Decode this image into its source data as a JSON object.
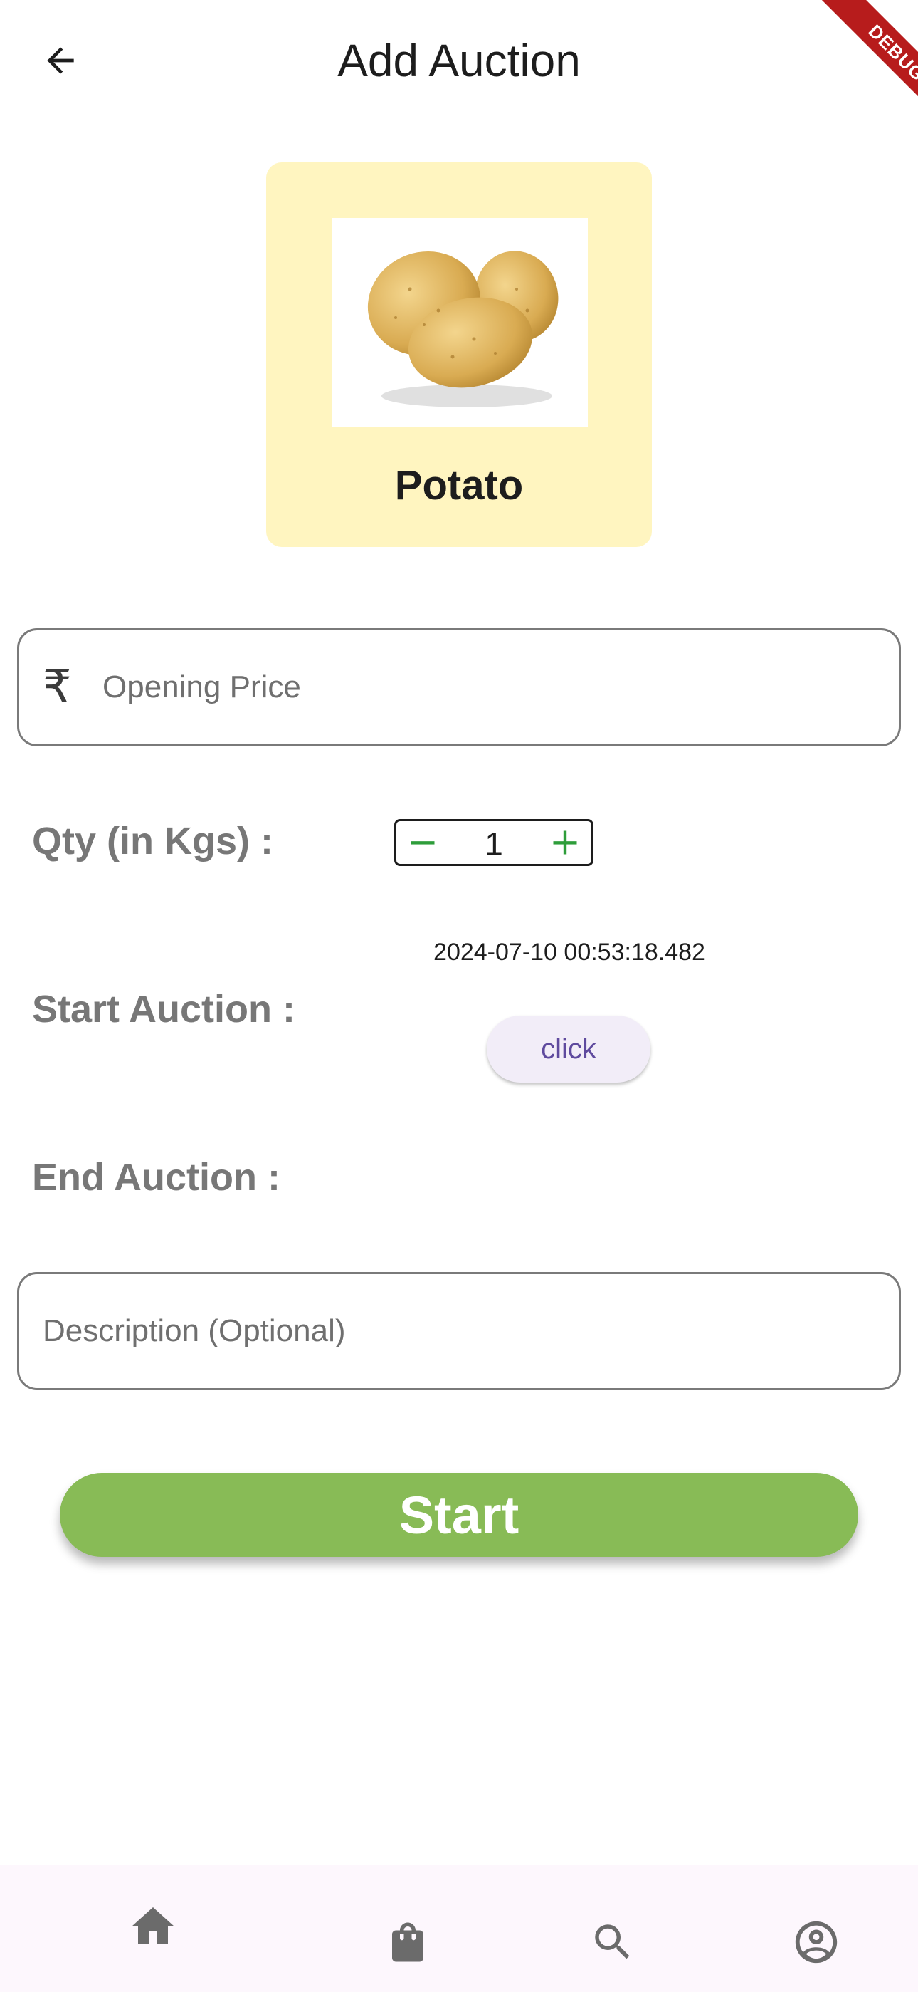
{
  "app_bar": {
    "title": "Add Auction",
    "back_icon": "arrow-back-icon",
    "debug_banner": "DEBUG"
  },
  "product": {
    "name": "Potato",
    "image": "potato-image"
  },
  "opening_price": {
    "currency_icon": "rupee-icon",
    "currency_symbol": "₹",
    "placeholder": "Opening Price",
    "value": ""
  },
  "quantity": {
    "label": "Qty (in Kgs) :",
    "value": "1",
    "decrement_symbol": "−",
    "increment_symbol": "+"
  },
  "start_auction": {
    "label": "Start Auction :",
    "datetime": "2024-07-10 00:53:18.482",
    "button_label": "click"
  },
  "end_auction": {
    "label": "End Auction :"
  },
  "description": {
    "placeholder": "Description (Optional)",
    "value": ""
  },
  "submit": {
    "label": "Start"
  },
  "bottom_nav": {
    "items": [
      {
        "icon": "home-icon"
      },
      {
        "icon": "shopping-bag-icon"
      },
      {
        "icon": "search-icon"
      },
      {
        "icon": "account-circle-icon"
      }
    ]
  },
  "colors": {
    "card_background": "#fff5c0",
    "start_button": "#88bb56",
    "stepper_accent": "#2e9d3a",
    "click_button_text": "#5f4a9e",
    "debug_banner": "#b71c1c"
  }
}
